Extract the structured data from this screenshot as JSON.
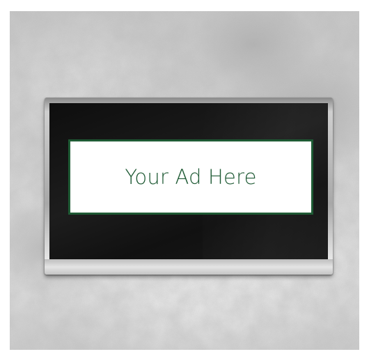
{
  "advertisement": {
    "text": "Your Ad Here",
    "text_color": "#1e5a34",
    "border_color": "#1e5a34",
    "background_color": "#ffffff"
  },
  "display": {
    "screen_color": "#151515",
    "bezel_color": "#c8c8c8"
  },
  "scene": {
    "wall_color": "#d4d4d4"
  }
}
